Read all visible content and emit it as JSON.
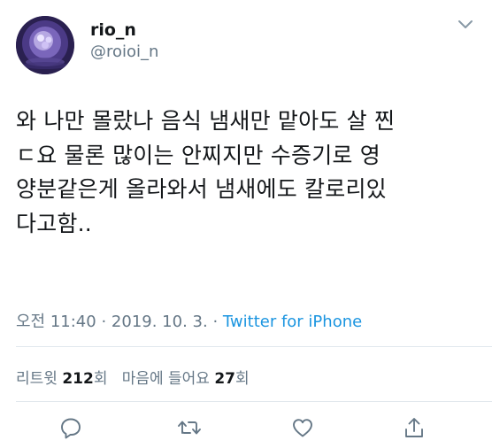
{
  "user": {
    "display_name": "rio_n",
    "handle": "@roioi_n"
  },
  "tweet": {
    "lines": [
      "와 나만 몰랐나 음식 냄새만 맡아도 살 찐",
      "ㄷ요 물론 많이는 안찌지만 수증기로 영",
      "양분같은게 올라와서 냄새에도 칼로리있",
      "다고함.."
    ],
    "time": "오전 11:40",
    "date": "2019. 10. 3.",
    "separator": "·",
    "source": "Twitter for iPhone"
  },
  "stats": {
    "retweet_label": "리트윗",
    "retweet_count": "212",
    "retweet_unit": "회",
    "like_label": "마음에 들어요",
    "like_count": "27",
    "like_unit": "회"
  },
  "icons": {
    "reply": "reply-icon",
    "retweet": "retweet-icon",
    "like": "like-icon",
    "share": "share-icon",
    "more": "chevron-down-icon"
  },
  "colors": {
    "text": "#14171a",
    "secondary": "#657786",
    "link": "#1b95e0",
    "divider": "#e1e8ed"
  }
}
